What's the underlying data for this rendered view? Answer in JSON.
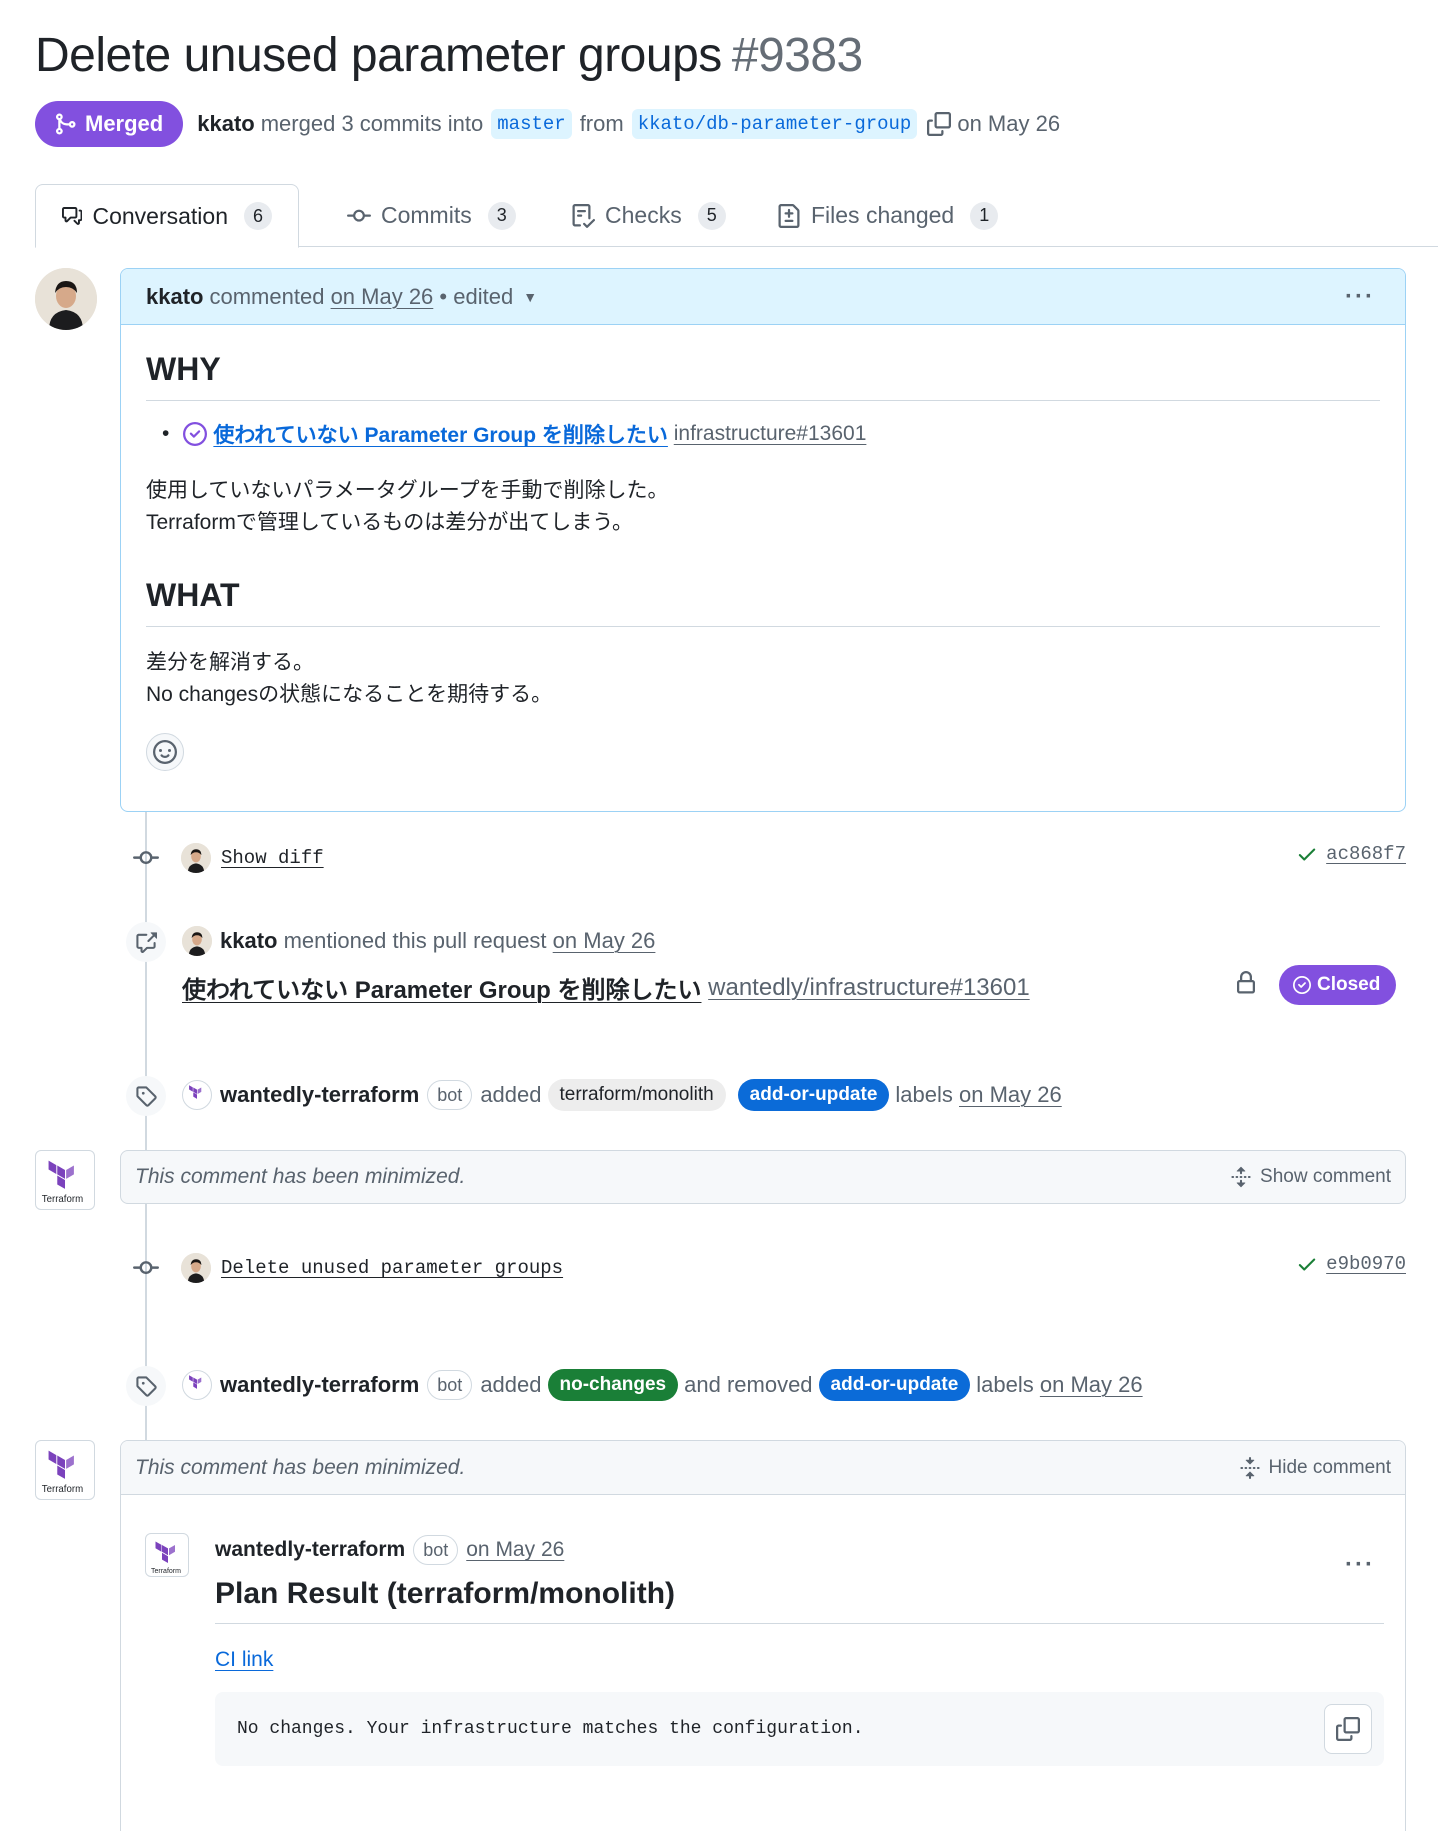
{
  "header": {
    "title": "Delete unused parameter groups",
    "number": "#9383",
    "state": "Merged",
    "author": "kkato",
    "merged_text": "merged 3 commits into",
    "base_branch": "master",
    "from_text": "from",
    "head_branch": "kkato/db-parameter-group",
    "date": "on May 26"
  },
  "tabs": [
    {
      "label": "Conversation",
      "count": "6"
    },
    {
      "label": "Commits",
      "count": "3"
    },
    {
      "label": "Checks",
      "count": "5"
    },
    {
      "label": "Files changed",
      "count": "1"
    }
  ],
  "comment": {
    "author": "kkato",
    "commented": "commented",
    "date": "on May 26",
    "edited": "• edited",
    "why_heading": "WHY",
    "issue_link_title": "使われていない Parameter Group を削除したい",
    "issue_ref": "infrastructure#13601",
    "why_line1": "使用していないパラメータグループを手動で削除した。",
    "why_line2": "Terraformで管理しているものは差分が出てしまう。",
    "what_heading": "WHAT",
    "what_line1": "差分を解消する。",
    "what_line2": "No changesの状態になることを期待する。"
  },
  "commit1": {
    "message": "Show diff",
    "sha": "ac868f7"
  },
  "mention": {
    "author": "kkato",
    "text": "mentioned this pull request",
    "date": "on May 26",
    "issue_title": "使われていない Parameter Group を削除したい",
    "issue_ref": "wantedly/infrastructure#13601",
    "status": "Closed"
  },
  "label_event1": {
    "actor": "wantedly-terraform",
    "bot": "bot",
    "added": "added",
    "label_a": "terraform/monolith",
    "label_b": "add-or-update",
    "labels": "labels",
    "date": "on May 26"
  },
  "minimized1": {
    "text": "This comment has been minimized.",
    "toggle": "Show comment"
  },
  "commit2": {
    "message": "Delete unused parameter groups",
    "sha": "e9b0970"
  },
  "label_event2": {
    "actor": "wantedly-terraform",
    "bot": "bot",
    "added": "added",
    "label_a": "no-changes",
    "removed": "and removed",
    "label_b": "add-or-update",
    "labels": "labels",
    "date": "on May 26"
  },
  "minimized2": {
    "text": "This comment has been minimized.",
    "toggle": "Hide comment"
  },
  "plan_comment": {
    "author": "wantedly-terraform",
    "bot": "bot",
    "date": "on May 26",
    "heading": "Plan Result (terraform/monolith)",
    "ci_link": "CI link",
    "code": "No changes. Your infrastructure matches the configuration."
  },
  "bot_avatar_text": "Terraform",
  "colors": {
    "merged": "#8250df",
    "link": "#0969da",
    "label_add_or_update": "#0b6bd8",
    "label_no_changes": "#1a7f37",
    "label_monolith_bg": "#ededed",
    "terraform_purple": "#7b42bc"
  }
}
